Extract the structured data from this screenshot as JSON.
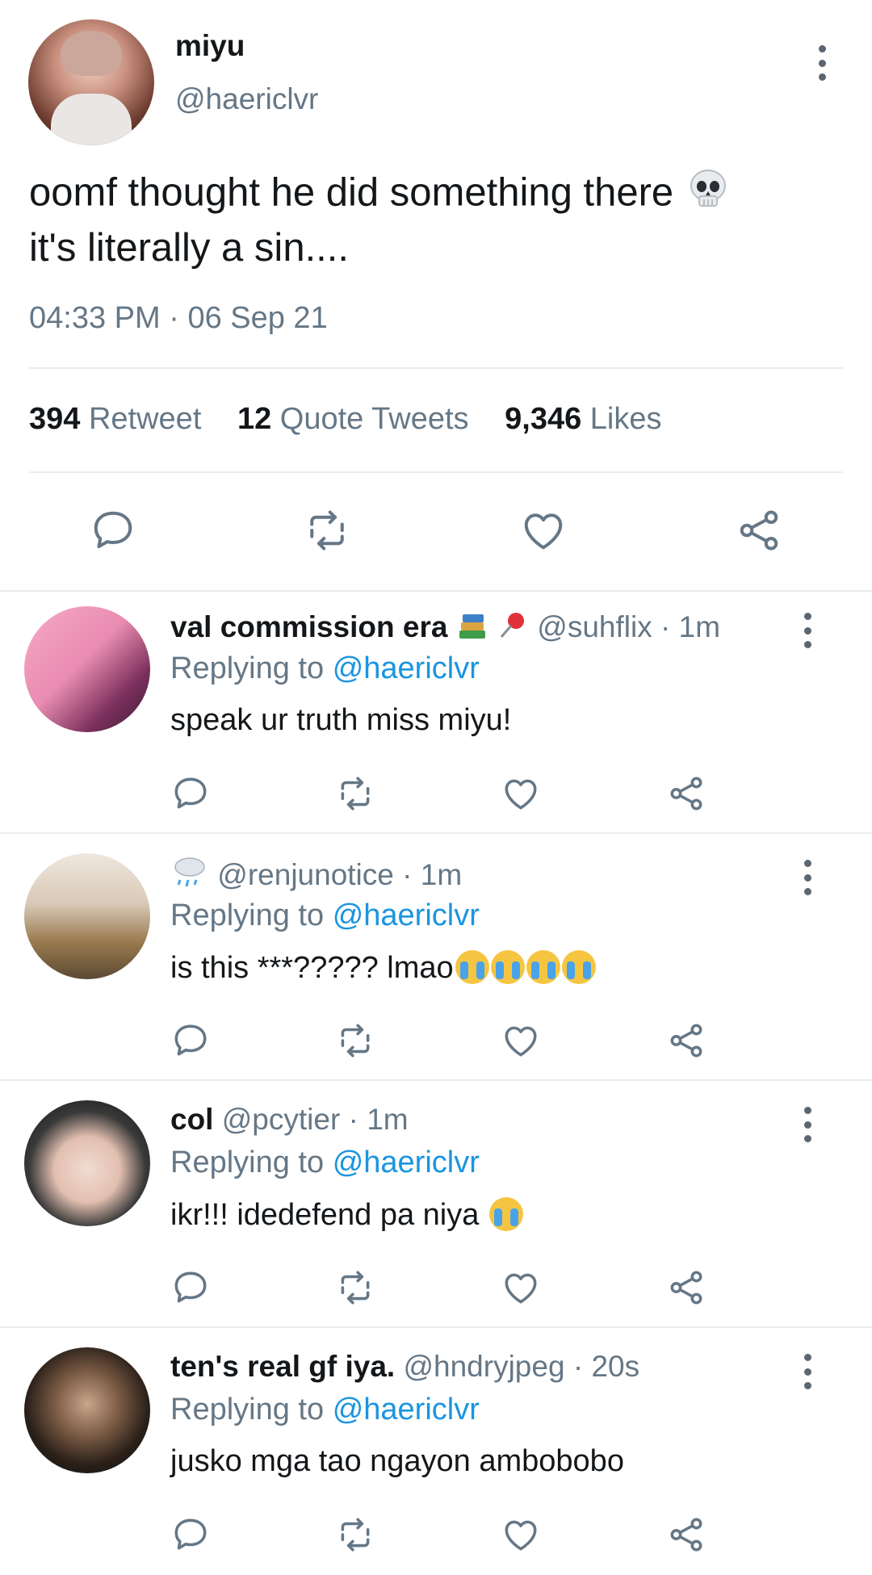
{
  "tweet": {
    "name": "miyu",
    "handle": "@haericlvr",
    "text_line1": "oomf thought he did something there",
    "text_line2": "it's literally a sin....",
    "time": "04:33 PM",
    "date": "06 Sep 21",
    "stats": {
      "retweets_count": "394",
      "retweets_label": "Retweet",
      "quotes_count": "12",
      "quotes_label": "Quote Tweets",
      "likes_count": "9,346",
      "likes_label": "Likes"
    }
  },
  "replies": [
    {
      "name": "val commission era",
      "name_emojis": [
        "books-icon",
        "pushpin-icon"
      ],
      "handle": "@suhflix",
      "time": "1m",
      "replying_prefix": "Replying to",
      "replying_to": "@haericlvr",
      "text": "speak ur truth miss miyu!"
    },
    {
      "name": "",
      "name_emojis": [
        "rain-cloud-icon"
      ],
      "handle": "@renjunotice",
      "time": "1m",
      "replying_prefix": "Replying to",
      "replying_to": "@haericlvr",
      "text": "is this ***????? lmao",
      "trailing_emojis": [
        "crying-face-icon",
        "crying-face-icon",
        "crying-face-icon",
        "crying-face-icon"
      ]
    },
    {
      "name": "col",
      "handle": "@pcytier",
      "time": "1m",
      "replying_prefix": "Replying to",
      "replying_to": "@haericlvr",
      "text": "ikr!!! idedefend pa niya",
      "trailing_emojis": [
        "crying-face-icon"
      ]
    },
    {
      "name": "ten's real gf iya.",
      "handle": "@hndryjpeg",
      "time": "20s",
      "replying_prefix": "Replying to",
      "replying_to": "@haericlvr",
      "text": "jusko mga tao ngayon ambobobo"
    }
  ],
  "colors": {
    "accent": "#1b95e0",
    "secondary_text": "#657786",
    "divider": "#e6ecf0"
  },
  "icons": [
    "reply-icon",
    "retweet-icon",
    "like-icon",
    "share-icon",
    "more-options-icon",
    "skull-icon"
  ]
}
